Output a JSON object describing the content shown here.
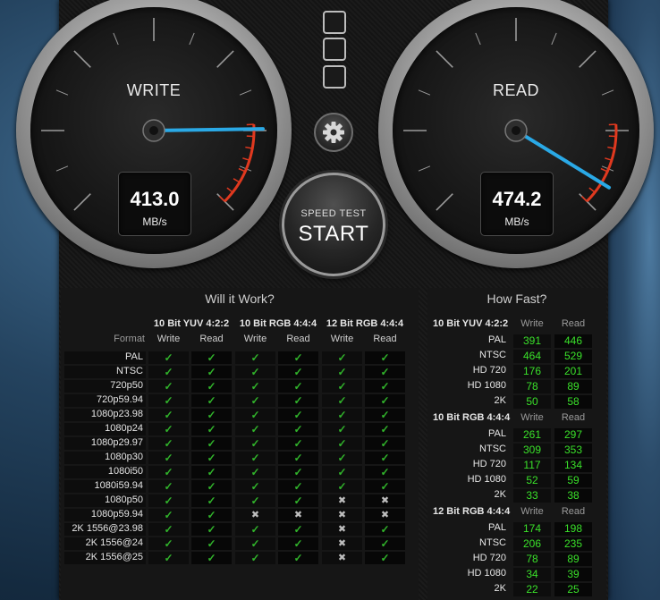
{
  "write_gauge": {
    "label": "WRITE",
    "value": "413.0",
    "unit": "MB/s",
    "needle_fraction": 0.83
  },
  "read_gauge": {
    "label": "READ",
    "value": "474.2",
    "unit": "MB/s",
    "needle_fraction": 0.95
  },
  "controls": {
    "start_small": "SPEED TEST",
    "start_big": "START",
    "gear_icon": "gear-icon",
    "layout_icon": "window-layout-icon"
  },
  "will_it_work": {
    "title": "Will it Work?",
    "format_label": "Format",
    "groups": [
      {
        "name": "10 Bit YUV 4:2:2",
        "cols": [
          "Write",
          "Read"
        ]
      },
      {
        "name": "10 Bit RGB 4:4:4",
        "cols": [
          "Write",
          "Read"
        ]
      },
      {
        "name": "12 Bit RGB 4:4:4",
        "cols": [
          "Write",
          "Read"
        ]
      }
    ],
    "rows": [
      {
        "format": "PAL",
        "status": [
          "ok",
          "ok",
          "ok",
          "ok",
          "ok",
          "ok"
        ]
      },
      {
        "format": "NTSC",
        "status": [
          "ok",
          "ok",
          "ok",
          "ok",
          "ok",
          "ok"
        ]
      },
      {
        "format": "720p50",
        "status": [
          "ok",
          "ok",
          "ok",
          "ok",
          "ok",
          "ok"
        ]
      },
      {
        "format": "720p59.94",
        "status": [
          "ok",
          "ok",
          "ok",
          "ok",
          "ok",
          "ok"
        ]
      },
      {
        "format": "1080p23.98",
        "status": [
          "ok",
          "ok",
          "ok",
          "ok",
          "ok",
          "ok"
        ]
      },
      {
        "format": "1080p24",
        "status": [
          "ok",
          "ok",
          "ok",
          "ok",
          "ok",
          "ok"
        ]
      },
      {
        "format": "1080p29.97",
        "status": [
          "ok",
          "ok",
          "ok",
          "ok",
          "ok",
          "ok"
        ]
      },
      {
        "format": "1080p30",
        "status": [
          "ok",
          "ok",
          "ok",
          "ok",
          "ok",
          "ok"
        ]
      },
      {
        "format": "1080i50",
        "status": [
          "ok",
          "ok",
          "ok",
          "ok",
          "ok",
          "ok"
        ]
      },
      {
        "format": "1080i59.94",
        "status": [
          "ok",
          "ok",
          "ok",
          "ok",
          "ok",
          "ok"
        ]
      },
      {
        "format": "1080p50",
        "status": [
          "ok",
          "ok",
          "ok",
          "ok",
          "no",
          "no"
        ]
      },
      {
        "format": "1080p59.94",
        "status": [
          "ok",
          "ok",
          "no",
          "no",
          "no",
          "no"
        ]
      },
      {
        "format": "2K 1556@23.98",
        "status": [
          "ok",
          "ok",
          "ok",
          "ok",
          "no",
          "ok"
        ]
      },
      {
        "format": "2K 1556@24",
        "status": [
          "ok",
          "ok",
          "ok",
          "ok",
          "no",
          "ok"
        ]
      },
      {
        "format": "2K 1556@25",
        "status": [
          "ok",
          "ok",
          "ok",
          "ok",
          "no",
          "ok"
        ]
      }
    ]
  },
  "how_fast": {
    "title": "How Fast?",
    "col_write": "Write",
    "col_read": "Read",
    "sections": [
      {
        "name": "10 Bit YUV 4:2:2",
        "rows": [
          {
            "format": "PAL",
            "write": "391",
            "read": "446"
          },
          {
            "format": "NTSC",
            "write": "464",
            "read": "529"
          },
          {
            "format": "HD 720",
            "write": "176",
            "read": "201"
          },
          {
            "format": "HD 1080",
            "write": "78",
            "read": "89"
          },
          {
            "format": "2K",
            "write": "50",
            "read": "58"
          }
        ]
      },
      {
        "name": "10 Bit RGB 4:4:4",
        "rows": [
          {
            "format": "PAL",
            "write": "261",
            "read": "297"
          },
          {
            "format": "NTSC",
            "write": "309",
            "read": "353"
          },
          {
            "format": "HD 720",
            "write": "117",
            "read": "134"
          },
          {
            "format": "HD 1080",
            "write": "52",
            "read": "59"
          },
          {
            "format": "2K",
            "write": "33",
            "read": "38"
          }
        ]
      },
      {
        "name": "12 Bit RGB 4:4:4",
        "rows": [
          {
            "format": "PAL",
            "write": "174",
            "read": "198"
          },
          {
            "format": "NTSC",
            "write": "206",
            "read": "235"
          },
          {
            "format": "HD 720",
            "write": "78",
            "read": "89"
          },
          {
            "format": "HD 1080",
            "write": "34",
            "read": "39"
          },
          {
            "format": "2K",
            "write": "22",
            "read": "25"
          }
        ]
      }
    ]
  },
  "colors": {
    "accent": "#2aa9e6",
    "ok": "#31b42b",
    "number": "#3ae02a",
    "redzone": "#e0391f"
  }
}
